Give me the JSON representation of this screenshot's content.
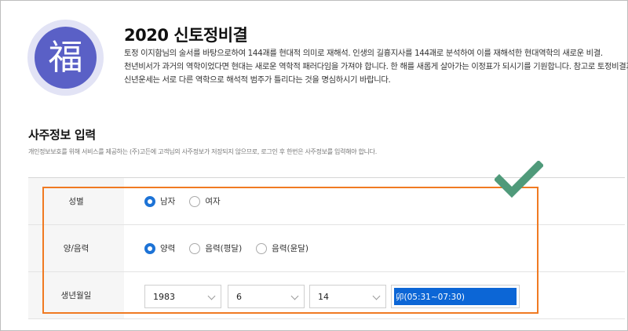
{
  "header": {
    "emblem_char": "福",
    "title": "2020 신토정비결",
    "desc_lines": [
      "토정 이지함님의 술서를 바탕으로하여 144괘를 현대적 의미로 재해석. 인생의 길흉지사를 144괘로 분석하여 이를 재해석한 현대역학의 새로운 비결.",
      "천년비서가 과거의 역학이었다면 현대는 새로운 역학적 패러다임을 가져야 합니다. 한 해를 새롭게 살아가는 이정표가 되시기를 기원합니다. 참고로 토정비결과",
      "신년운세는 서로 다른 역학으로 해석적 범주가 틀리다는 것을 명심하시기 바랍니다."
    ]
  },
  "section": {
    "title": "사주정보 입력",
    "note": "개인정보보호를 위해 서비스를 제공하는 (주)고든에 고객님의 사주정보가 저장되지 않으므로, 로그인 후 한번은 사주정보를 입력해야 합니다."
  },
  "form": {
    "gender": {
      "label": "성별",
      "options": [
        "남자",
        "여자"
      ],
      "selected": 0
    },
    "calendar": {
      "label": "양/음력",
      "options": [
        "양력",
        "음력(평달)",
        "음력(윤달)"
      ],
      "selected": 0
    },
    "birth": {
      "label": "생년월일",
      "year": "1983",
      "month": "6",
      "day": "14",
      "time": "卯(05:31~07:30)"
    }
  },
  "colors": {
    "emblem": "#5a60c6",
    "radio_on": "#1d73d6",
    "highlight": "#f07a22",
    "check": "#4f9a7a"
  }
}
